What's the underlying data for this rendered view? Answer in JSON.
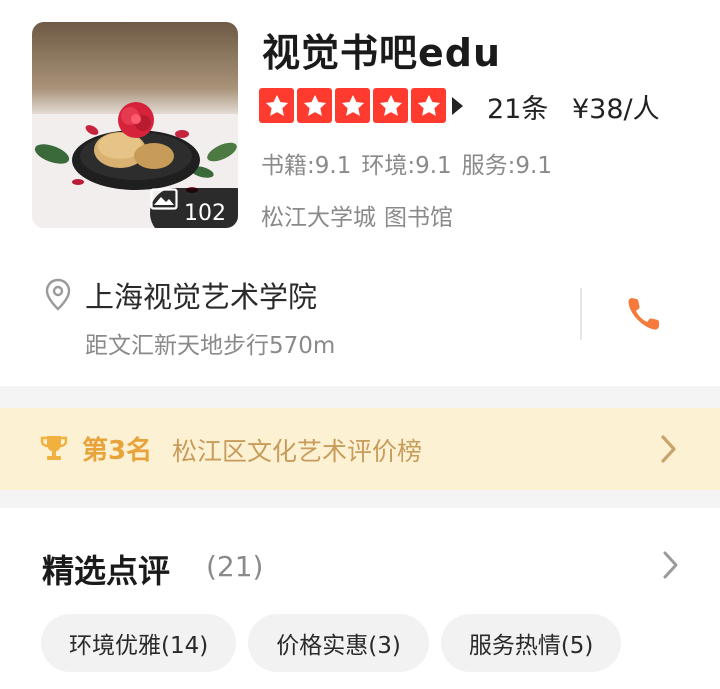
{
  "shop": {
    "name": "视觉书吧edu",
    "photo_count": "102",
    "rating_stars": 5,
    "review_count": "21条",
    "price": "¥38/人",
    "scores": [
      "书籍:9.1",
      "环境:9.1",
      "服务:9.1"
    ],
    "tags": [
      "松江大学城",
      "图书馆"
    ]
  },
  "address": {
    "name": "上海视觉艺术学院",
    "distance": "距文汇新天地步行570m"
  },
  "ranking": {
    "rank": "第3名",
    "list_name": "松江区文化艺术评价榜"
  },
  "reviews_section": {
    "title": "精选点评",
    "count": "(21)",
    "chips": [
      "环境优雅(14)",
      "价格实惠(3)",
      "服务热情(5)"
    ]
  },
  "colors": {
    "star_red": "#ff3b30",
    "phone_orange": "#f57a3c",
    "rank_gold": "#e8a33a",
    "rank_bg": "#fdf1d4"
  },
  "icons": [
    "image-icon",
    "star-icon",
    "location-pin-icon",
    "phone-icon",
    "trophy-icon",
    "chevron-right-icon"
  ]
}
